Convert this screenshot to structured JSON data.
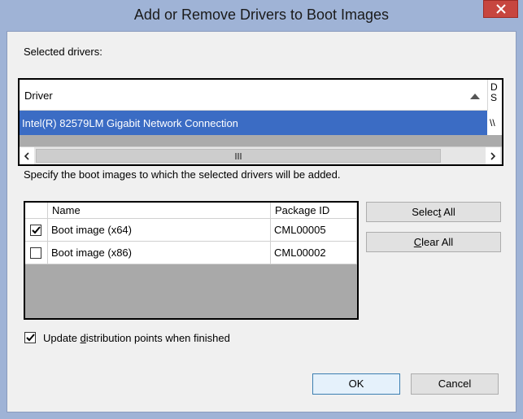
{
  "window": {
    "title": "Add or Remove Drivers to Boot Images"
  },
  "drivers": {
    "label": "Selected drivers:",
    "columns": [
      "Driver",
      "D\nS"
    ],
    "rows": [
      {
        "driver": "Intel(R) 82579LM Gigabit Network Connection",
        "source": "\\\\"
      }
    ]
  },
  "boot_images": {
    "label": "Specify the boot images to which the selected drivers will be added.",
    "columns": {
      "name": "Name",
      "package_id": "Package ID"
    },
    "rows": [
      {
        "name": "Boot image (x64)",
        "package_id": "CML00005",
        "checked": true
      },
      {
        "name": "Boot image (x86)",
        "package_id": "CML00002",
        "checked": false
      }
    ]
  },
  "buttons": {
    "select_all_pre": "Selec",
    "select_all_key": "t",
    "select_all_post": " All",
    "clear_all_key": "C",
    "clear_all_post": "lear All",
    "ok": "OK",
    "cancel": "Cancel"
  },
  "update_dp": {
    "pre": "Update ",
    "key": "d",
    "post": "istribution points when finished",
    "checked": true
  },
  "colors": {
    "selection": "#3b6cc4",
    "close": "#c7463f",
    "frame": "#9fb3d6"
  }
}
